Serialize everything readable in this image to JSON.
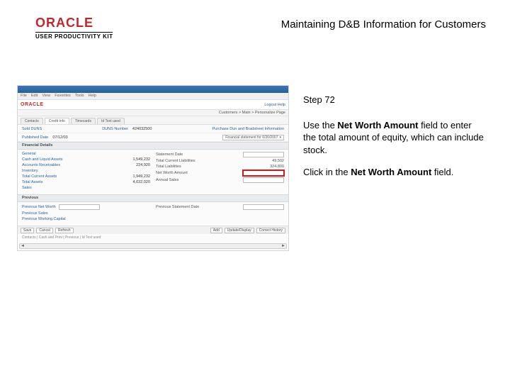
{
  "header": {
    "logo_text": "ORACLE",
    "logo_sub": "USER PRODUCTIVITY KIT",
    "title": "Maintaining D&B Information for Customers"
  },
  "side": {
    "step": "Step 72",
    "para1_pre": "Use the ",
    "para1_bold": "Net Worth Amount",
    "para1_post": " field to enter the total amount of equity, which can include stock.",
    "para2_pre": "Click in the ",
    "para2_bold": "Net Worth Amount",
    "para2_post": " field."
  },
  "shot": {
    "menubar": [
      "File",
      "Edit",
      "View",
      "Favorites",
      "Tools",
      "Help"
    ],
    "mini_oracle": "ORACLE",
    "nav_right": "Logout Help",
    "crumb_right": "Customers > Main > Personalize Page",
    "tabs": [
      "Contacts",
      "Credit Info",
      "Timecards",
      "Id Text used"
    ],
    "active_tab": 1,
    "row1_k1": "Sold DUNS",
    "row1_k2": "DUNS Number",
    "row1_v2": "424032500",
    "row1_right": "Purchase Dun and Bradstreet Information",
    "row2_k": "Published Date",
    "row2_v": "07/12/03",
    "row2_sel": "Financial statement for 6/30/2007",
    "section1": "Financial Details",
    "section2": "Previous",
    "left_ledger": [
      {
        "k": "General",
        "v": ""
      },
      {
        "k": "Cash and Liquid Assets",
        "v": "1,549,232"
      },
      {
        "k": "Accounts Receivables",
        "v": "224,920"
      },
      {
        "k": "Inventory",
        "v": ""
      },
      {
        "k": "Total Current Assets",
        "v": "1,949,232"
      },
      {
        "k": "Total Assets",
        "v": "4,632,020"
      },
      {
        "k": "Sales",
        "v": ""
      }
    ],
    "right_rows": [
      {
        "k": "Statement Date",
        "v": ""
      },
      {
        "k": "Total Current Liabilities",
        "v": "49,502"
      },
      {
        "k": "Total Liabilities",
        "v": "324,800"
      },
      {
        "k": "Net Worth Amount",
        "v": "",
        "hl": true
      },
      {
        "k": "Annual Sales",
        "v": ""
      }
    ],
    "prev_left_k": "Previous Net Worth",
    "prev_right_k": "Previous Statement Date",
    "prev_ledger": [
      {
        "k": "Previous Sales",
        "v": ""
      },
      {
        "k": "Previous Working Capital",
        "v": ""
      }
    ],
    "toolbar_left": [
      "Save",
      "Cancel",
      "Refresh"
    ],
    "toolbar_right": [
      "Add",
      "Update/Display",
      "Correct History"
    ],
    "hint": "Contacts | Cash and Prev | Previous | Id Text used"
  }
}
